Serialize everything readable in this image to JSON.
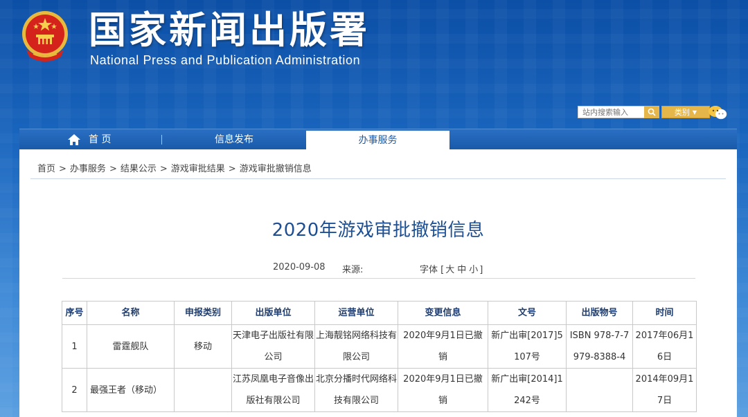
{
  "header": {
    "title": "国家新闻出版署",
    "subtitle": "National  Press and Publication Administration",
    "emblem_icon": "national-emblem-icon"
  },
  "search": {
    "placeholder": "站内搜索输入",
    "category_label": "类别"
  },
  "nav": {
    "items": [
      {
        "label": "首 页"
      },
      {
        "label": "信息发布"
      },
      {
        "label": "办事服务"
      }
    ],
    "active_index": 2
  },
  "breadcrumb": [
    "首页",
    "办事服务",
    "结果公示",
    "游戏审批结果",
    "游戏审批撤销信息"
  ],
  "breadcrumb_sep": ">",
  "article": {
    "title": "2020年游戏审批撤销信息",
    "date": "2020-09-08",
    "source_label": "来源:",
    "font_label": "字体",
    "font_sizes": [
      "大",
      "中",
      "小"
    ]
  },
  "table": {
    "headers": [
      "序号",
      "名称",
      "申报类别",
      "出版单位",
      "运营单位",
      "变更信息",
      "文号",
      "出版物号",
      "时间"
    ],
    "rows": [
      [
        "1",
        "雷霆舰队",
        "移动",
        "天津电子出版社有限公司",
        "上海靓铭网络科技有限公司",
        "2020年9月1日已撤销",
        "新广出审[2017]5107号",
        "ISBN 978-7-7979-8388-4",
        "2017年06月16日"
      ],
      [
        "2",
        "最强王者（移动）",
        "",
        "江苏凤凰电子音像出版社有限公司",
        "北京分播时代网络科技有限公司",
        "2020年9月1日已撤销",
        "新广出审[2014]1242号",
        "",
        "2014年09月17日"
      ]
    ]
  },
  "colors": {
    "header_blue": "#0c4fa6",
    "title_blue": "#1d4f92",
    "accent_gold": "#e5b64a",
    "emblem_red": "#d4231a"
  }
}
